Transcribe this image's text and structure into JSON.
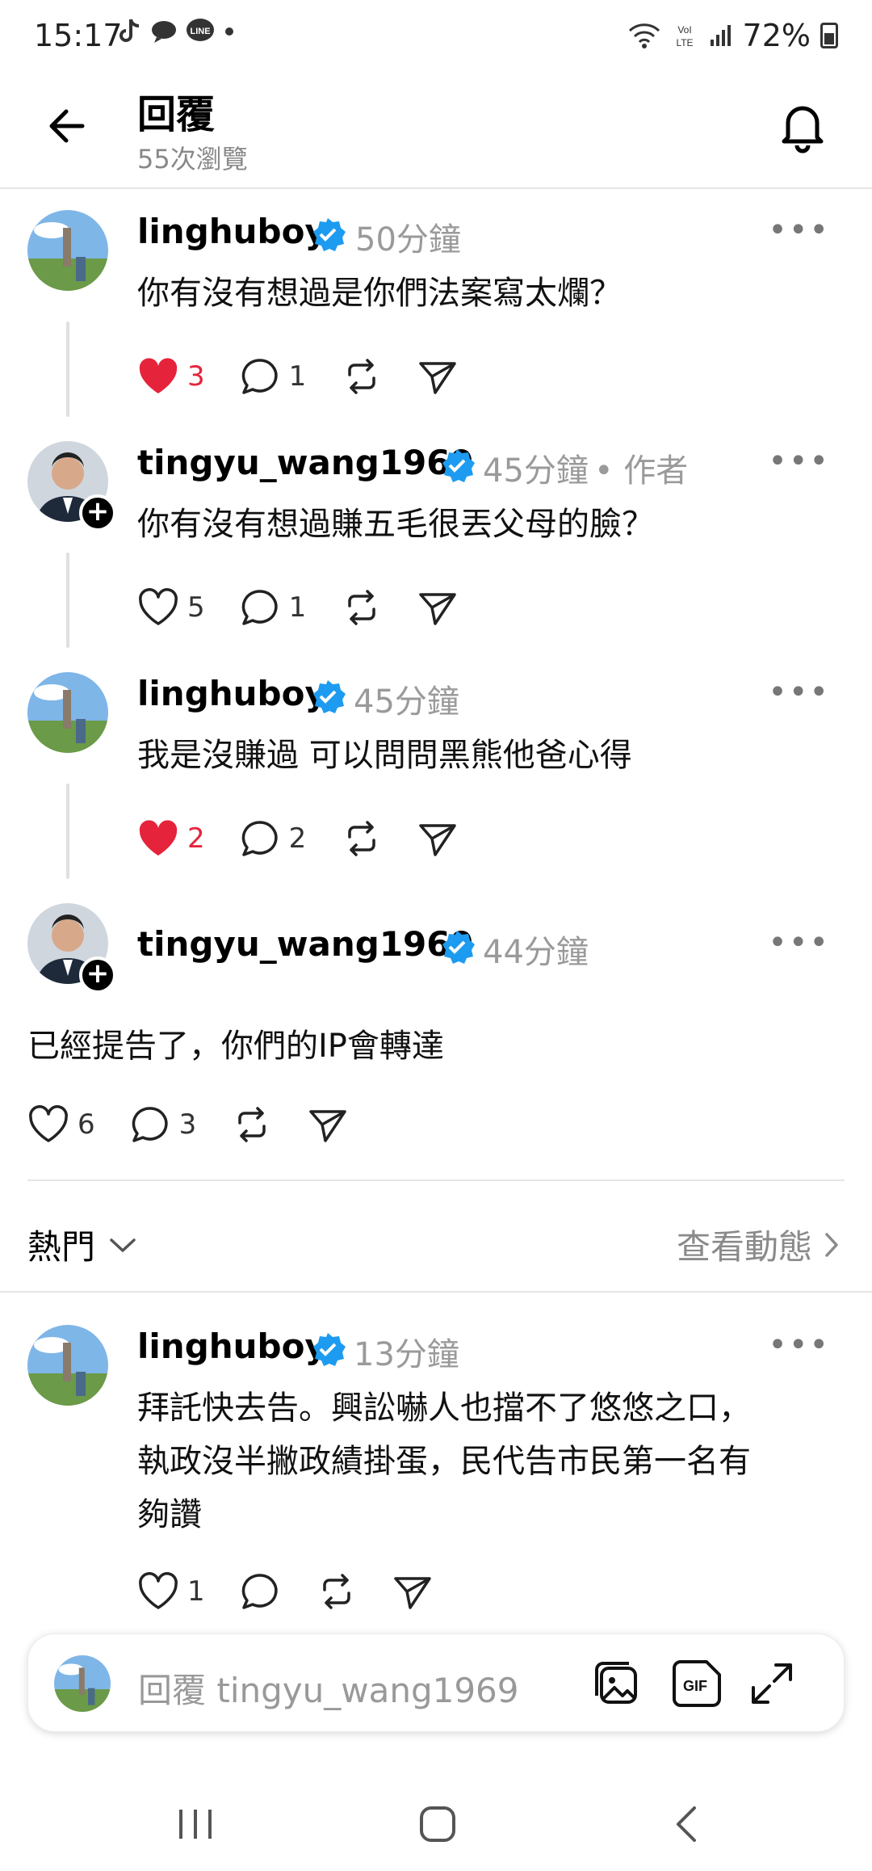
{
  "status_bar": {
    "time": "15:17",
    "battery": "72%"
  },
  "header": {
    "title": "回覆",
    "views": "55次瀏覽"
  },
  "comments": [
    {
      "user": "linghuboy",
      "time": "50分鐘",
      "text": "你有沒有想過是你們法案寫太爛？",
      "likes": "3",
      "liked": true,
      "replies": "1"
    },
    {
      "user": "tingyu_wang1969",
      "time": "45分鐘",
      "author_tag": "• 作者",
      "text": "你有沒有想過賺五毛很丟父母的臉？",
      "likes": "5",
      "liked": false,
      "replies": "1"
    },
    {
      "user": "linghuboy",
      "time": "45分鐘",
      "text": "我是沒賺過 可以問問黑熊他爸心得",
      "likes": "2",
      "liked": true,
      "replies": "2"
    }
  ],
  "main_post": {
    "user": "tingyu_wang1969",
    "time": "44分鐘",
    "text": "已經提告了，你們的IP會轉達",
    "likes": "6",
    "replies": "3"
  },
  "sort": {
    "label": "熱門",
    "activity": "查看動態"
  },
  "reply_item": {
    "user": "linghuboy",
    "time": "13分鐘",
    "lines": [
      "拜託快去告。興訟嚇人也擋不了悠悠之口，",
      "執政沒半撇政績掛蛋，民代告市民第一名有",
      "夠讚"
    ],
    "likes": "1"
  },
  "reply_bar": {
    "placeholder": "回覆 tingyu_wang1969"
  },
  "colors": {
    "verified": "#1d9bf0",
    "like_red": "#e5243b",
    "muted": "#9a9a9a"
  }
}
